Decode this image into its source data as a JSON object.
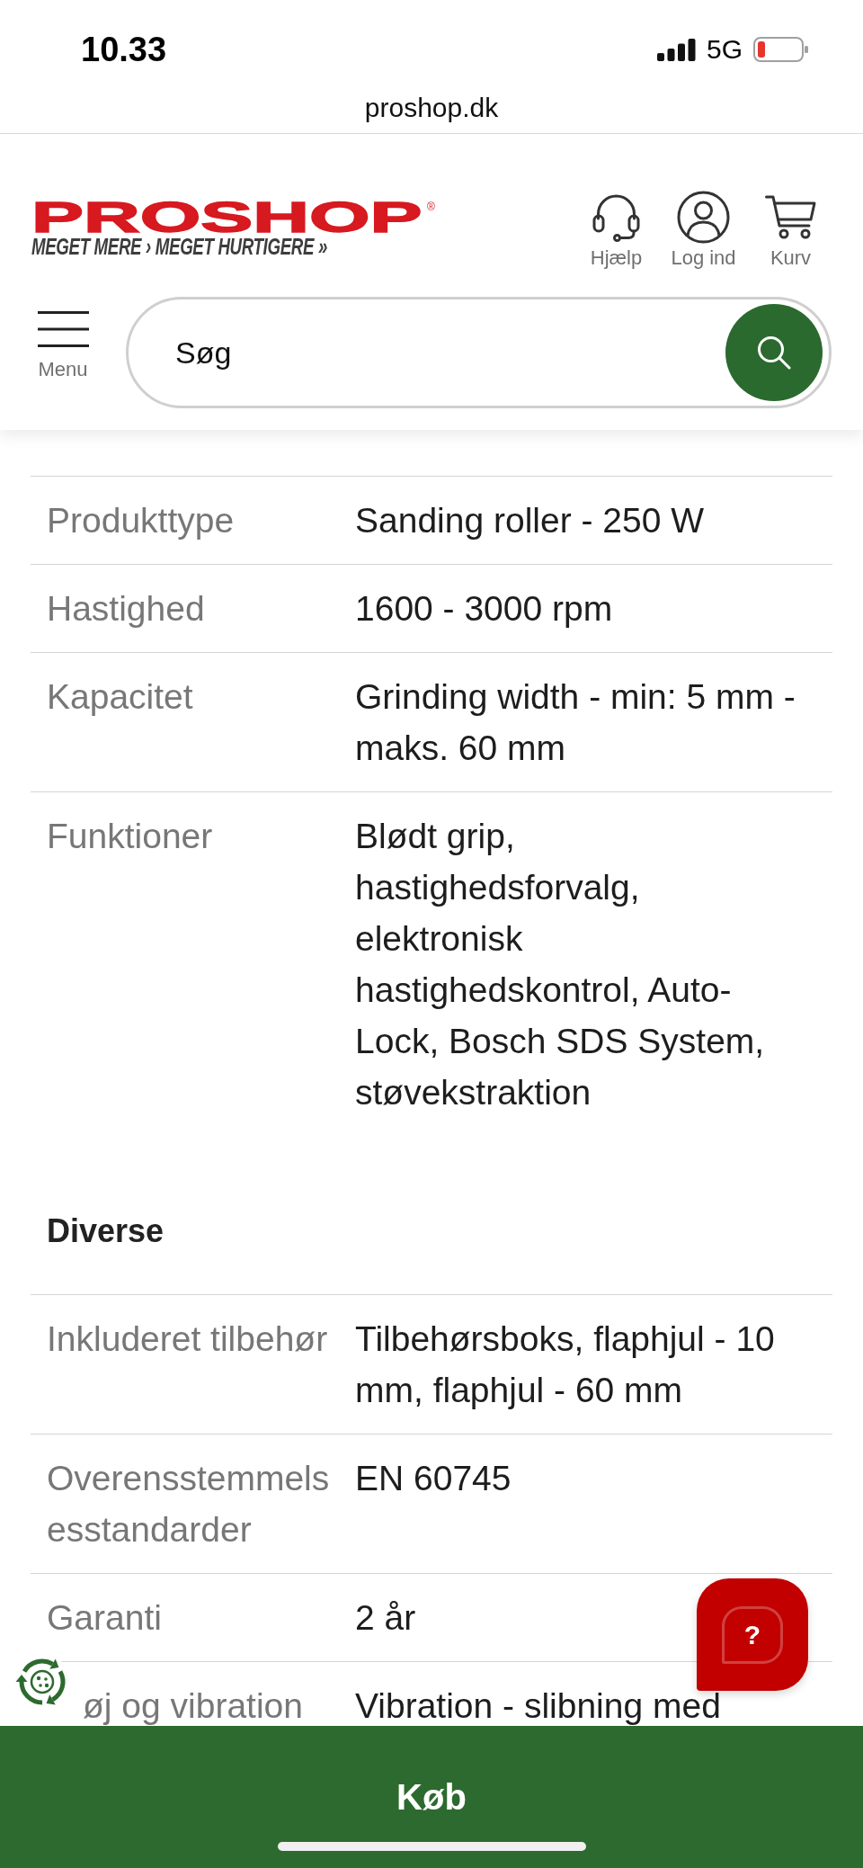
{
  "status_bar": {
    "time": "10.33",
    "network": "5G"
  },
  "address_bar": {
    "url": "proshop.dk"
  },
  "header": {
    "logo": {
      "wordmark": "PROSHOP",
      "registered_mark": "®",
      "tagline": "MEGET MERE › MEGET HURTIGERE »"
    },
    "actions": [
      {
        "label": "Hjælp"
      },
      {
        "label": "Log ind"
      },
      {
        "label": "Kurv"
      }
    ],
    "menu": {
      "label": "Menu"
    },
    "search": {
      "placeholder": "Søg"
    }
  },
  "spec_sections": [
    {
      "rows": [
        {
          "label": "Produkttype",
          "value": "Sanding roller - 250 W"
        },
        {
          "label": "Hastighed",
          "value": "1600 - 3000 rpm"
        },
        {
          "label": "Kapacitet",
          "value": "Grinding width - min: 5 mm - maks. 60 mm"
        },
        {
          "label": "Funktioner",
          "value": "Blødt grip, hastighedsforvalg, elektronisk hastighedskontrol, Auto-Lock, Bosch SDS System, støvekstraktion"
        }
      ]
    },
    {
      "heading": "Diverse",
      "rows": [
        {
          "label": "Inkluderet tilbehør",
          "value": "Tilbehørsboks, flaphjul - 10 mm, flaphjul - 60 mm"
        },
        {
          "label": "Overensstemmelsesstandarder",
          "value": "EN 60745"
        },
        {
          "label": "Garanti",
          "value": "2 år"
        },
        {
          "label": "øj og vibration",
          "value": "Vibration - slibning med"
        }
      ]
    }
  ],
  "help_button": {
    "label": "?"
  },
  "buy_button": {
    "label": "Køb"
  }
}
